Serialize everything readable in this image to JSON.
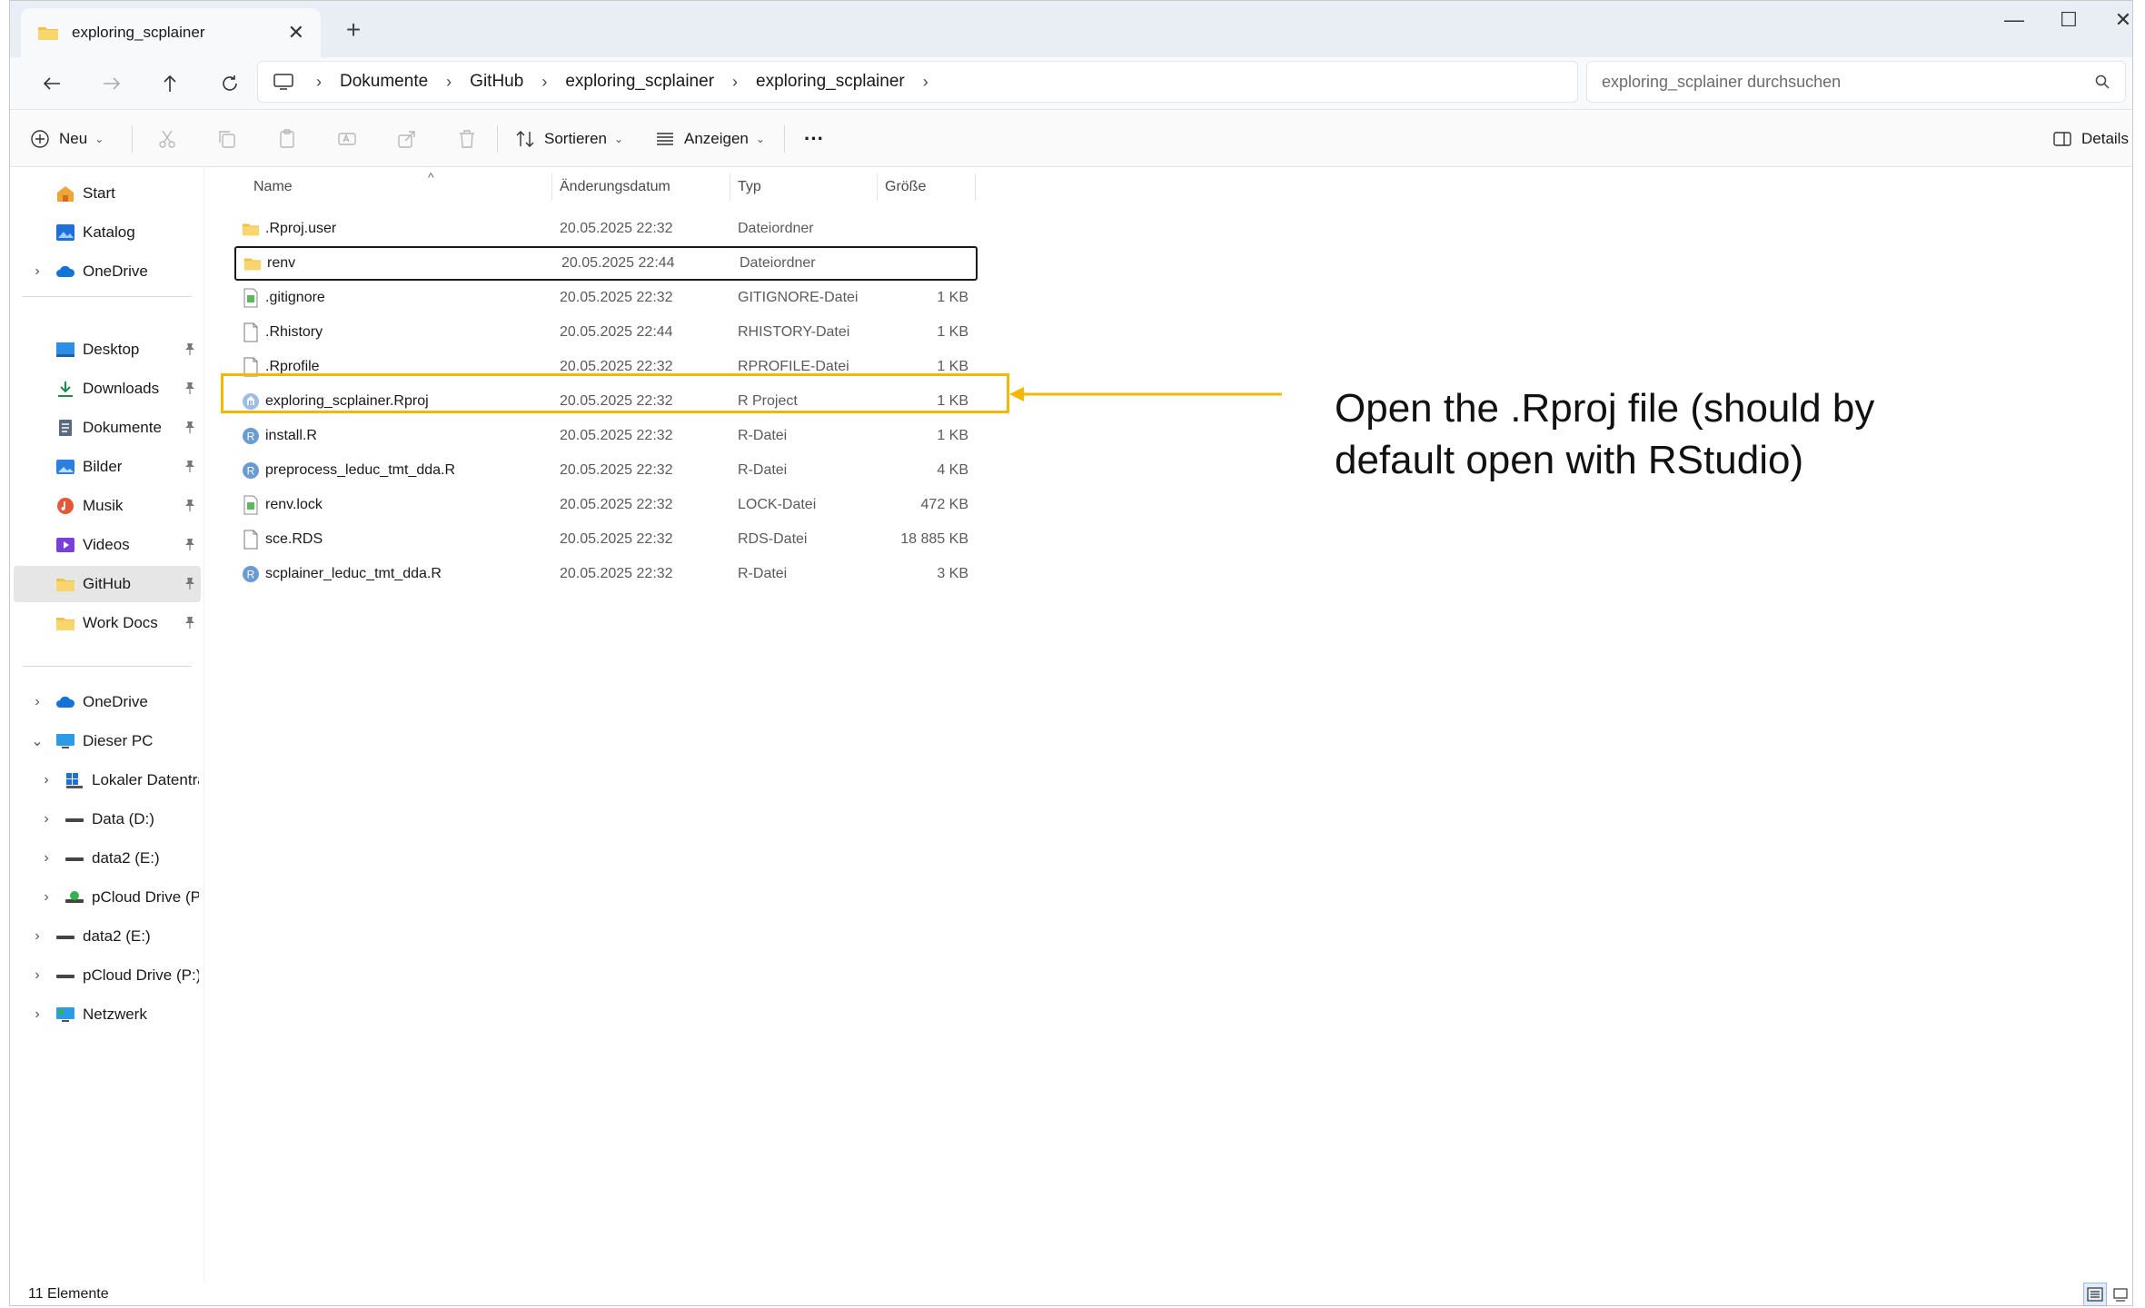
{
  "window": {
    "tab_title": "exploring_scplainer",
    "close_glyph": "✕",
    "new_tab_glyph": "+",
    "minimize_glyph": "—",
    "maximize_glyph": "☐",
    "window_close_glyph": "✕"
  },
  "address": {
    "crumbs": [
      "Dokumente",
      "GitHub",
      "exploring_scplainer",
      "exploring_scplainer"
    ],
    "separator": "›"
  },
  "search": {
    "placeholder": "exploring_scplainer durchsuchen"
  },
  "toolbar": {
    "new_label": "Neu",
    "sort_label": "Sortieren",
    "view_label": "Anzeigen",
    "more_glyph": "···",
    "details_label": "Details",
    "dropdown_glyph": "⌄"
  },
  "sidebar": {
    "items": [
      {
        "label": "Start"
      },
      {
        "label": "Katalog"
      },
      {
        "label": "OneDrive"
      },
      {
        "label": "Desktop"
      },
      {
        "label": "Downloads"
      },
      {
        "label": "Dokumente"
      },
      {
        "label": "Bilder"
      },
      {
        "label": "Musik"
      },
      {
        "label": "Videos"
      },
      {
        "label": "GitHub"
      },
      {
        "label": "Work Docs"
      },
      {
        "label": "OneDrive"
      },
      {
        "label": "Dieser PC"
      },
      {
        "label": "Lokaler Datenträg"
      },
      {
        "label": "Data (D:)"
      },
      {
        "label": "data2 (E:)"
      },
      {
        "label": "pCloud Drive (P:)"
      },
      {
        "label": "data2 (E:)"
      },
      {
        "label": "pCloud Drive (P:)"
      },
      {
        "label": "Netzwerk"
      }
    ],
    "pin_glyph": "📌",
    "expand_glyph": "›",
    "collapse_glyph": "⌄"
  },
  "columns": {
    "name": "Name",
    "date": "Änderungsdatum",
    "type": "Typ",
    "size": "Größe",
    "sort_glyph": "^"
  },
  "files": [
    {
      "name": ".Rproj.user",
      "date": "20.05.2025 22:32",
      "type": "Dateiordner",
      "size": ""
    },
    {
      "name": "renv",
      "date": "20.05.2025 22:44",
      "type": "Dateiordner",
      "size": ""
    },
    {
      "name": ".gitignore",
      "date": "20.05.2025 22:32",
      "type": "GITIGNORE-Datei",
      "size": "1 KB"
    },
    {
      "name": ".Rhistory",
      "date": "20.05.2025 22:44",
      "type": "RHISTORY-Datei",
      "size": "1 KB"
    },
    {
      "name": ".Rprofile",
      "date": "20.05.2025 22:32",
      "type": "RPROFILE-Datei",
      "size": "1 KB"
    },
    {
      "name": "exploring_scplainer.Rproj",
      "date": "20.05.2025 22:32",
      "type": "R Project",
      "size": "1 KB"
    },
    {
      "name": "install.R",
      "date": "20.05.2025 22:32",
      "type": "R-Datei",
      "size": "1 KB"
    },
    {
      "name": "preprocess_leduc_tmt_dda.R",
      "date": "20.05.2025 22:32",
      "type": "R-Datei",
      "size": "4 KB"
    },
    {
      "name": "renv.lock",
      "date": "20.05.2025 22:32",
      "type": "LOCK-Datei",
      "size": "472 KB"
    },
    {
      "name": "sce.RDS",
      "date": "20.05.2025 22:32",
      "type": "RDS-Datei",
      "size": "18 885 KB"
    },
    {
      "name": "scplainer_leduc_tmt_dda.R",
      "date": "20.05.2025 22:32",
      "type": "R-Datei",
      "size": "3 KB"
    }
  ],
  "annotation": {
    "text": "Open the .Rproj file (should by default open with RStudio)",
    "color": "#f5b700"
  },
  "status": {
    "count": "11 Elemente"
  },
  "colors": {
    "folder": "#f2c04b",
    "r_badge": "#6b9bd2",
    "accent": "#0067c0"
  }
}
